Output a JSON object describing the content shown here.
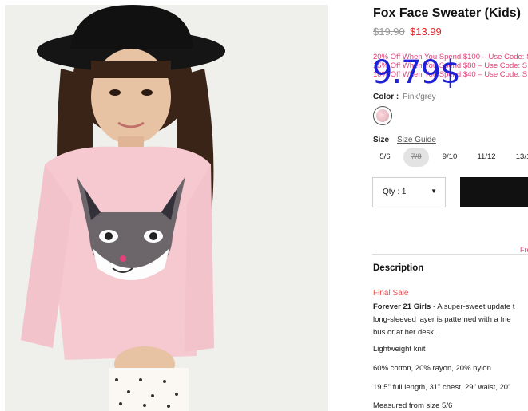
{
  "product": {
    "title": "Fox Face Sweater (Kids)",
    "price_original": "$19.90",
    "price_sale": "$13.99"
  },
  "promos": [
    "20% Off When You Spend $100 – Use Code: S",
    "15% Off When You Spend $80 – Use Code: S",
    "10% Off When You Spend $40 – Use Code: S"
  ],
  "overlay_text": "9.79$",
  "color": {
    "label": "Color :",
    "value": "Pink/grey"
  },
  "size": {
    "label": "Size",
    "guide": "Size Guide",
    "options": [
      "5/6",
      "7/8",
      "9/10",
      "11/12",
      "13/1"
    ]
  },
  "quantity": {
    "label": "Qty : 1"
  },
  "shipping_note": "Fre",
  "description": {
    "heading": "Description",
    "final_sale": "Final Sale",
    "brand": "Forever 21 Girls",
    "text_1": " - A super-sweet update t",
    "text_2": "long-sleeved layer is patterned with a frie",
    "text_3": "bus or at her desk.",
    "feature_1": "Lightweight knit",
    "feature_2": "60% cotton, 20% rayon, 20% nylon",
    "feature_3": "19.5\" full length, 31\" chest, 29\" waist, 20\"",
    "feature_4": "Measured from size 5/6"
  },
  "colors": {
    "sale": "#e02727",
    "promo": "#e0427a",
    "overlay": "#1f1fd8"
  }
}
